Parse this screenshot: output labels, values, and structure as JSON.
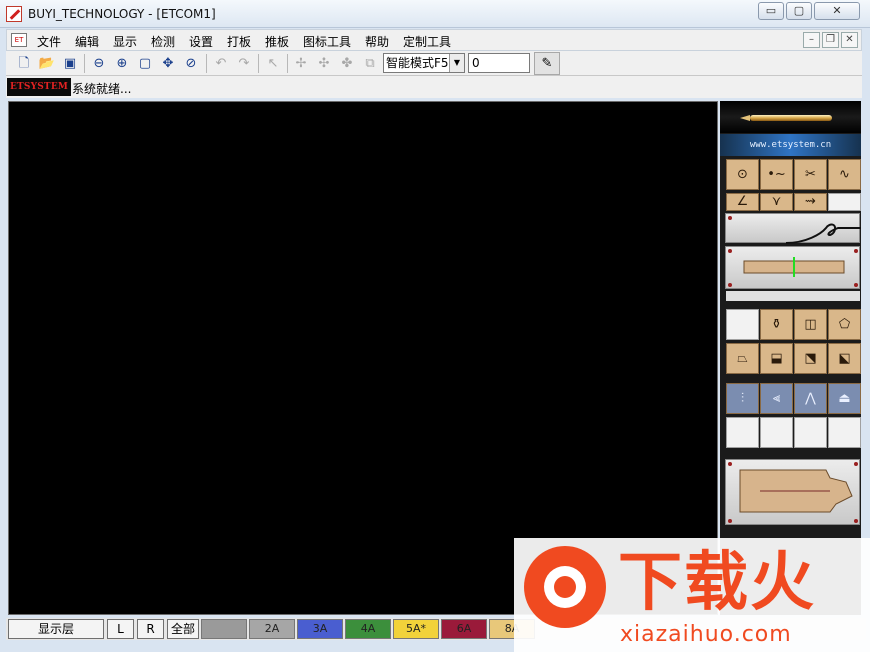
{
  "window": {
    "title": "BUYI_TECHNOLOGY - [ETCOM1]",
    "min_glyph": "▭",
    "max_glyph": "▢",
    "close_glyph": "✕"
  },
  "menu": {
    "icon_text": "ET",
    "items": [
      "文件",
      "编辑",
      "显示",
      "检测",
      "设置",
      "打板",
      "推板",
      "图标工具",
      "帮助",
      "定制工具"
    ],
    "mdi_min": "–",
    "mdi_restore": "❐",
    "mdi_close": "✕"
  },
  "toolbar": {
    "mode_value": "智能模式F5",
    "number_value": "0",
    "icons": [
      "new-file-icon",
      "open-folder-icon",
      "save-icon",
      "zoom-out-icon",
      "zoom-in-icon",
      "zoom-fit-icon",
      "pan-icon",
      "zoom-window-icon",
      "undo-icon",
      "redo-icon",
      "select-icon",
      "grade-point-icon",
      "grade-x-icon",
      "grade-y-icon",
      "grade-copy-icon",
      "pen-tool-icon"
    ]
  },
  "status": {
    "logo_text": "ETSYSTEM",
    "message": "系统就绪..."
  },
  "palette": {
    "url": "www.etsystem.cn"
  },
  "layers": {
    "display_label": "显示层",
    "left_label": "L",
    "right_label": "R",
    "all_label": "全部",
    "items": [
      {
        "label": "",
        "color": "#9a9a9a"
      },
      {
        "label": "2A",
        "color": "#a6a6a6"
      },
      {
        "label": "3A",
        "color": "#4a5ed0"
      },
      {
        "label": "4A",
        "color": "#3c8f3c"
      },
      {
        "label": "5A*",
        "color": "#f2d23a"
      },
      {
        "label": "6A",
        "color": "#9a1a3a"
      },
      {
        "label": "8A",
        "color": "#e8c87a"
      }
    ]
  },
  "watermark": {
    "brand_cn": "下载火",
    "brand_en": "xiazaihuo.com"
  }
}
